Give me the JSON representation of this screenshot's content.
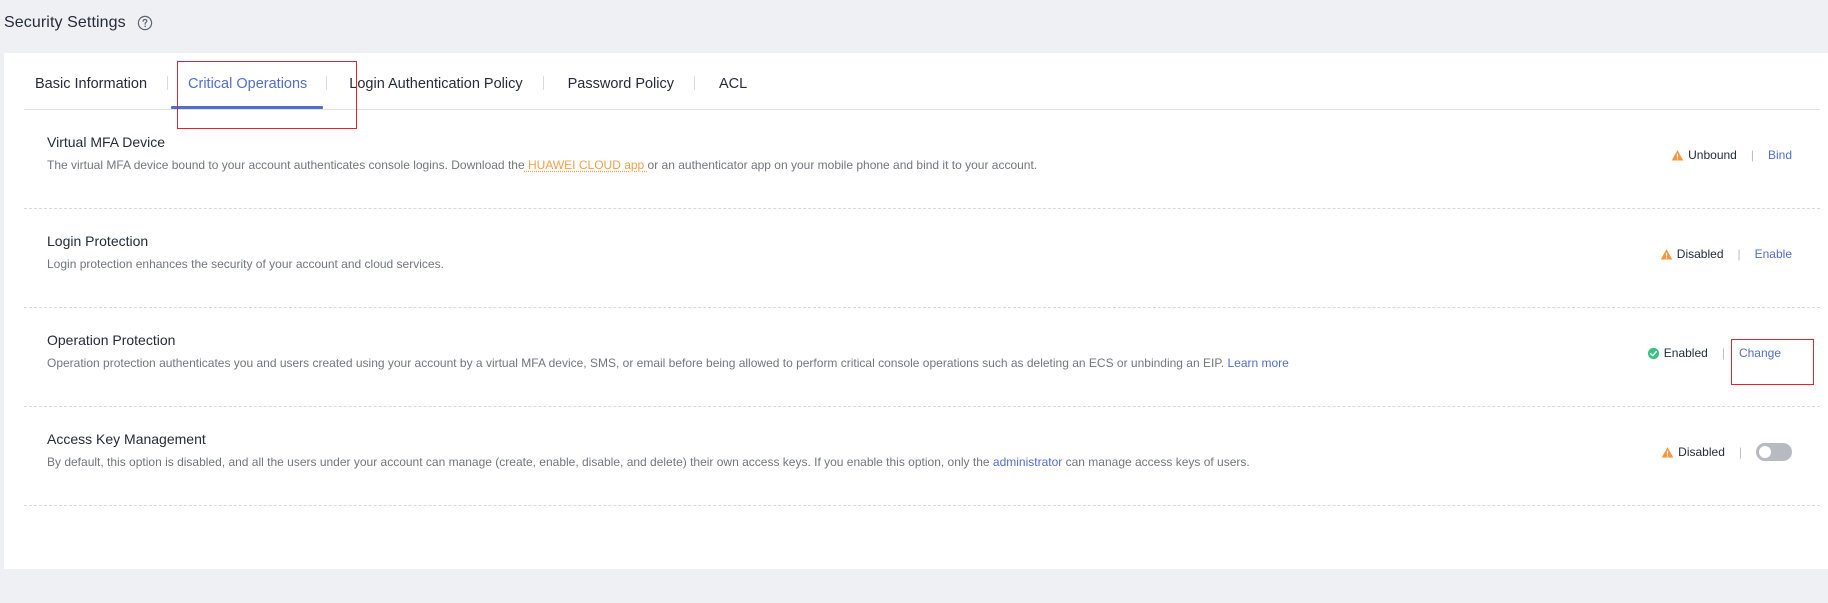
{
  "page": {
    "title": "Security Settings"
  },
  "tabs": [
    {
      "label": "Basic Information",
      "active": false
    },
    {
      "label": "Critical Operations",
      "active": true
    },
    {
      "label": "Login Authentication Policy",
      "active": false
    },
    {
      "label": "Password Policy",
      "active": false
    },
    {
      "label": "ACL",
      "active": false
    }
  ],
  "rows": {
    "mfa": {
      "title": "Virtual MFA Device",
      "desc_before": "The virtual MFA device bound to your account authenticates console logins. Download the",
      "desc_link": " HUAWEI CLOUD app ",
      "desc_after": "or an authenticator app on your mobile phone and bind it to your account.",
      "status": "Unbound",
      "action": "Bind"
    },
    "login_protection": {
      "title": "Login Protection",
      "desc": "Login protection enhances the security of your account and cloud services.",
      "status": "Disabled",
      "action": "Enable"
    },
    "operation_protection": {
      "title": "Operation Protection",
      "desc_before": "Operation protection authenticates you and users created using your account by a virtual MFA device, SMS, or email before being allowed to perform critical console operations such as deleting an ECS or unbinding an EIP.",
      "desc_link": "Learn more",
      "status": "Enabled",
      "action": "Change"
    },
    "access_key": {
      "title": "Access Key Management",
      "desc_before": "By default, this option is disabled, and all the users under your account can manage (create, enable, disable, and delete) their own access keys. If you enable this option, only the",
      "desc_link": "administrator",
      "desc_after": "can manage access keys of users.",
      "status": "Disabled",
      "toggle_on": false
    }
  },
  "colors": {
    "accent": "#526ecc",
    "warning": "#f5953d",
    "success": "#3cc083",
    "highlight": "#e0242f"
  },
  "icons": {
    "help": "help-circle-icon",
    "warning": "warning-triangle-icon",
    "success": "check-circle-icon"
  }
}
